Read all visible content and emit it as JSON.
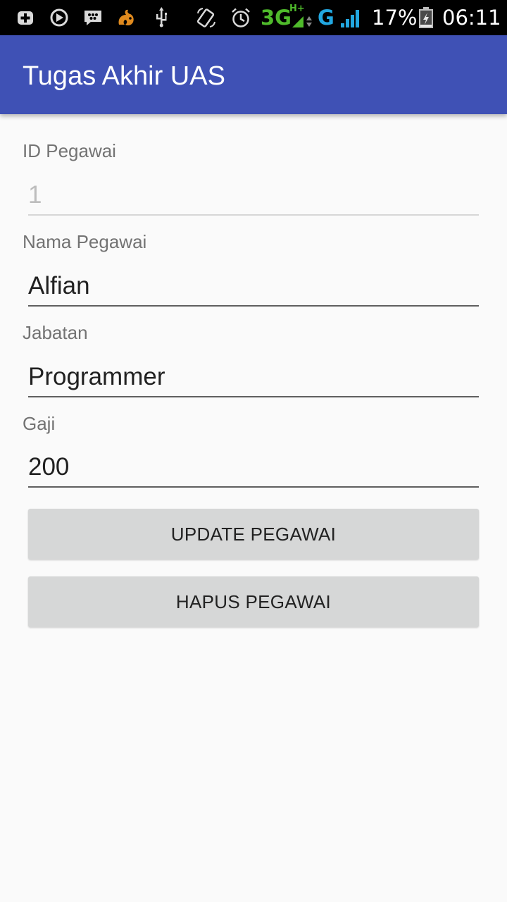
{
  "status_bar": {
    "network_3g": "3G",
    "network_hplus": "H+",
    "network_g": "G",
    "battery_percent": "17%",
    "time": "06:11",
    "icons": [
      "plus-icon",
      "sync-icon",
      "bbm-icon",
      "uc-browser-icon",
      "usb-icon",
      "rotate-icon",
      "alarm-icon",
      "signal-icon",
      "battery-icon"
    ]
  },
  "app_bar": {
    "title": "Tugas Akhir UAS",
    "color": "#3f51b5"
  },
  "form": {
    "id_label": "ID Pegawai",
    "id_value": "1",
    "name_label": "Nama Pegawai",
    "name_value": "Alfian",
    "position_label": "Jabatan",
    "position_value": "Programmer",
    "salary_label": "Gaji",
    "salary_value": "200"
  },
  "buttons": {
    "update_label": "UPDATE PEGAWAI",
    "delete_label": "HAPUS PEGAWAI"
  }
}
